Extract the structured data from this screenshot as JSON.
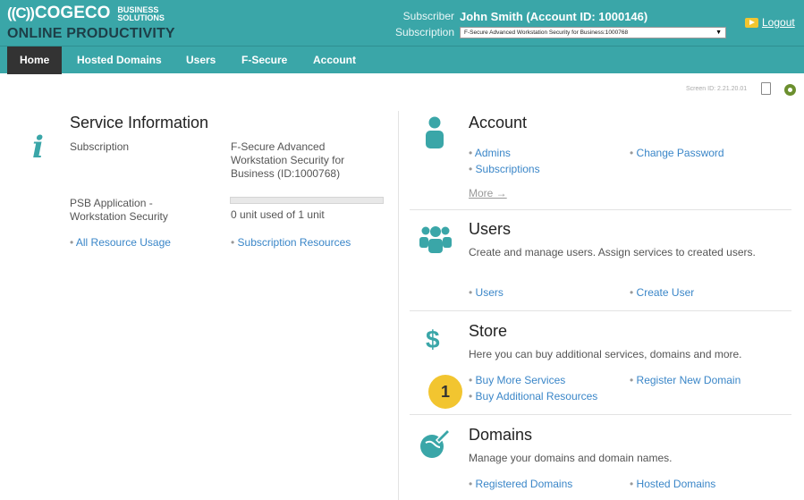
{
  "header": {
    "logo_mark": "((C))",
    "logo_word": "COGECO",
    "logo_bs_line1": "BUSINESS",
    "logo_bs_line2": "SOLUTIONS",
    "logo_product": "ONLINE PRODUCTIVITY",
    "subscriber_label": "Subscriber",
    "subscriber_value": "John Smith (Account ID: 1000146)",
    "subscription_label": "Subscription",
    "subscription_value": "F-Secure Advanced Workstation Security for Business:1000768",
    "logout_label": "Logout"
  },
  "nav": {
    "items": [
      {
        "label": "Home"
      },
      {
        "label": "Hosted Domains"
      },
      {
        "label": "Users"
      },
      {
        "label": "F-Secure"
      },
      {
        "label": "Account"
      }
    ]
  },
  "screen_id": "Screen ID: 2.21.20.01",
  "service": {
    "title": "Service Information",
    "subscription_label": "Subscription",
    "subscription_value": "F-Secure Advanced Workstation Security for Business (ID:1000768)",
    "psb_label": "PSB Application - Workstation Security",
    "usage_text": "0 unit used of 1 unit",
    "usage_fraction": 0,
    "link_all_usage": "All Resource Usage",
    "link_sub_resources": "Subscription Resources"
  },
  "account": {
    "title": "Account",
    "link_admins": "Admins",
    "link_change_password": "Change Password",
    "link_subscriptions": "Subscriptions",
    "more": "More →"
  },
  "users": {
    "title": "Users",
    "description": "Create and manage users. Assign services to created users.",
    "link_users": "Users",
    "link_create_user": "Create User"
  },
  "store": {
    "title": "Store",
    "description": "Here you can buy additional services, domains and more.",
    "link_buy_services": "Buy More Services",
    "link_register_domain": "Register New Domain",
    "link_buy_resources": "Buy Additional Resources",
    "badge": "1"
  },
  "domains": {
    "title": "Domains",
    "description": "Manage your domains and domain names.",
    "link_registered": "Registered Domains",
    "link_hosted": "Hosted Domains"
  },
  "colors": {
    "brand_teal": "#3aa6a8",
    "nav_active": "#333333",
    "link_blue": "#3a86c8",
    "badge_yellow": "#f2c530"
  }
}
